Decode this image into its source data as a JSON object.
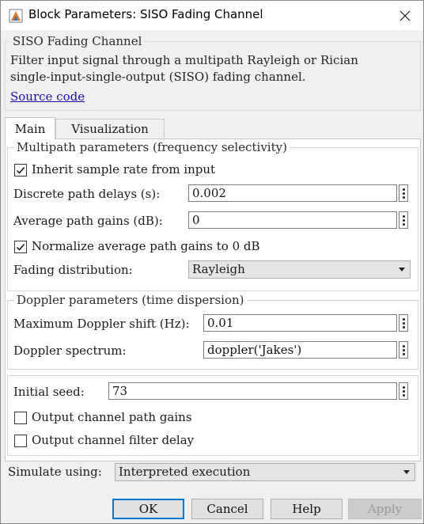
{
  "window": {
    "title": "Block Parameters: SISO Fading Channel"
  },
  "header": {
    "group_title": "SISO Fading Channel",
    "description_line1": "Filter input signal through a multipath Rayleigh or Rician",
    "description_line2": "single-input-single-output (SISO) fading channel.",
    "source_link": "Source code"
  },
  "tabs": [
    {
      "label": "Main",
      "active": true
    },
    {
      "label": "Visualization",
      "active": false
    }
  ],
  "multipath": {
    "title": "Multipath parameters (frequency selectivity)",
    "inherit_rate": {
      "label": "Inherit sample rate from input",
      "checked": true
    },
    "delays": {
      "label": "Discrete path delays (s):",
      "value": "0.002"
    },
    "gains": {
      "label": "Average path gains (dB):",
      "value": "0"
    },
    "normalize": {
      "label": "Normalize average path gains to 0 dB",
      "checked": true
    },
    "fading": {
      "label": "Fading distribution:",
      "value": "Rayleigh"
    }
  },
  "doppler": {
    "title": "Doppler parameters (time dispersion)",
    "max_shift": {
      "label": "Maximum Doppler shift (Hz):",
      "value": "0.01"
    },
    "spectrum": {
      "label": "Doppler spectrum:",
      "value": "doppler('Jakes')"
    }
  },
  "seed_group": {
    "seed": {
      "label": "Initial seed:",
      "value": "73"
    },
    "path_gains": {
      "label": "Output channel path gains",
      "checked": false
    },
    "filter_delay": {
      "label": "Output channel filter delay",
      "checked": false
    }
  },
  "simulate": {
    "label": "Simulate using:",
    "value": "Interpreted execution"
  },
  "buttons": {
    "ok": "OK",
    "cancel": "Cancel",
    "help": "Help",
    "apply": "Apply"
  },
  "icons": {
    "app": "simulink-block-icon",
    "close": "close-icon",
    "more": "vertical-ellipsis-icon",
    "dropdown": "chevron-down-icon",
    "check": "checkmark-icon"
  },
  "colors": {
    "link": "#1a0dab",
    "default_button_border": "#0078d7",
    "window_bg": "#f0f0f0",
    "panel_bg": "#ffffff"
  }
}
